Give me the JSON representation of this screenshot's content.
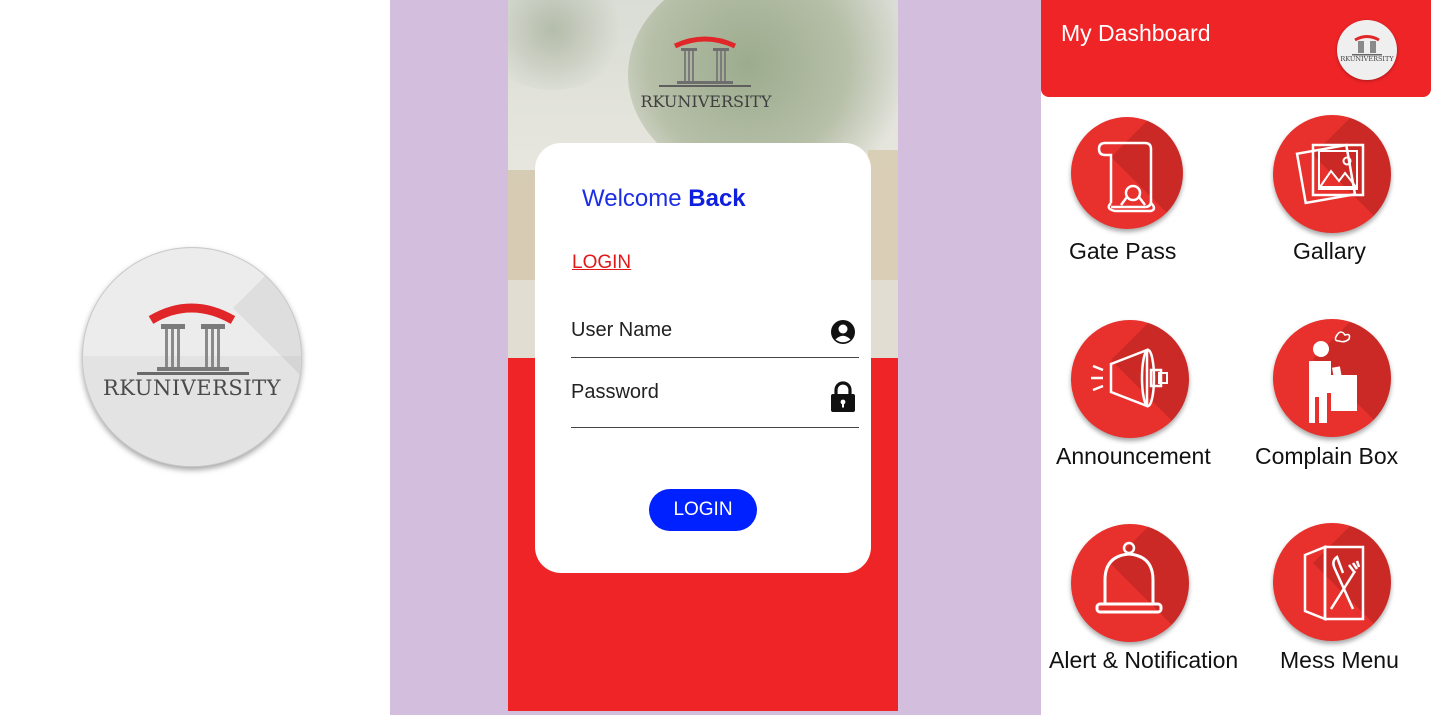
{
  "logo": {
    "text": "RKUNIVERSITY"
  },
  "login": {
    "welcome_prefix": "Welcome",
    "welcome_bold": "Back",
    "tab_label": "LOGIN",
    "username_placeholder": "User Name",
    "password_placeholder": "Password",
    "button_label": "LOGIN"
  },
  "dashboard": {
    "title": "My Dashboard",
    "tiles": [
      {
        "label": "Gate Pass",
        "icon": "scroll-icon"
      },
      {
        "label": "Gallary",
        "icon": "gallery-icon"
      },
      {
        "label": "Announcement",
        "icon": "megaphone-icon"
      },
      {
        "label": "Complain Box",
        "icon": "complaint-box-icon"
      },
      {
        "label": "Alert & Notification",
        "icon": "bell-icon"
      },
      {
        "label": "Mess Menu",
        "icon": "menu-card-icon"
      }
    ]
  },
  "colors": {
    "brand_red": "#ef2427",
    "accent_blue": "#0021ff",
    "background_purple": "#d3bfdd"
  }
}
